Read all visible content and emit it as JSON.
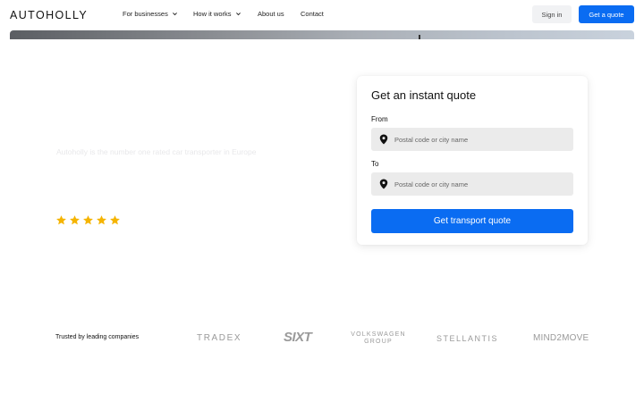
{
  "header": {
    "logo": "AUTOHOLLY",
    "nav": [
      {
        "label": "For businesses",
        "has_dropdown": true
      },
      {
        "label": "How it works",
        "has_dropdown": true
      },
      {
        "label": "About us",
        "has_dropdown": false
      },
      {
        "label": "Contact",
        "has_dropdown": false
      }
    ],
    "sign_in": "Sign in",
    "get_quote": "Get a quote"
  },
  "hero": {
    "tagline": "Autoholly is the number one rated car transporter in Europe",
    "rating_stars": 5,
    "star_color": "#f5b400"
  },
  "quote_card": {
    "title": "Get an instant quote",
    "from_label": "From",
    "from_placeholder": "Postal code or city name",
    "to_label": "To",
    "to_placeholder": "Postal code or city name",
    "submit": "Get transport quote"
  },
  "trusted": {
    "label": "Trusted by leading companies",
    "companies": [
      "TRADEX",
      "SIXT",
      "VOLKSWAGEN",
      "GROUP",
      "STELLANTIS",
      "MIND2MOVE"
    ]
  },
  "colors": {
    "accent": "#0a6cf2",
    "field_bg": "#ebebeb",
    "logo_gray": "#9a9a9a"
  }
}
